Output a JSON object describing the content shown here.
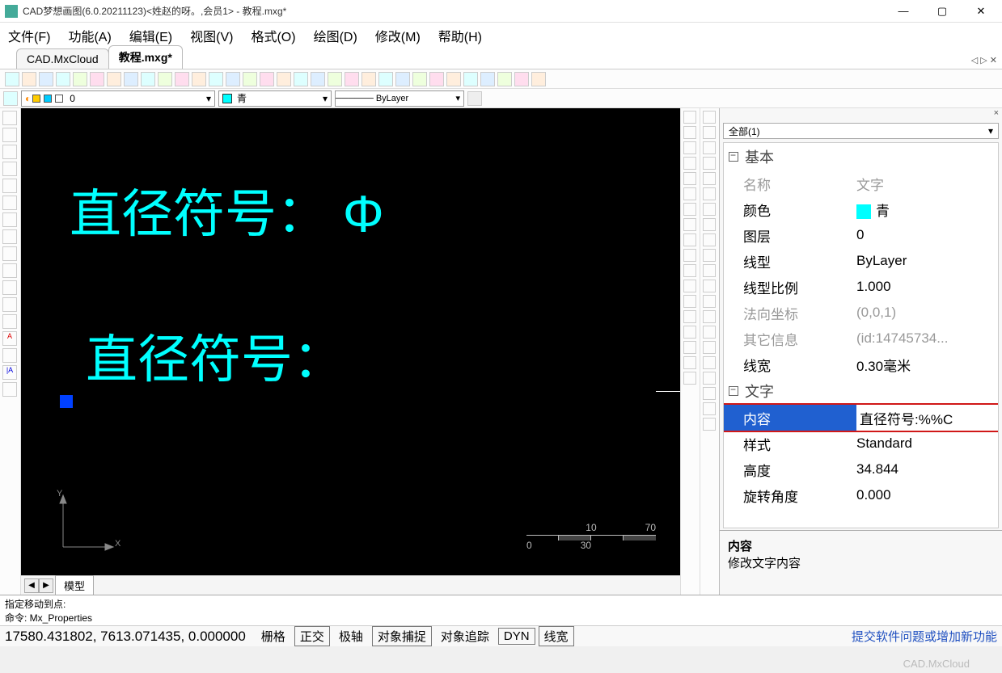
{
  "window": {
    "title": "CAD梦想画图(6.0.20211123)<姓赵的呀。,会员1> - 教程.mxg*",
    "min": "—",
    "max": "▢",
    "close": "✕"
  },
  "menu": {
    "file": "文件(F)",
    "func": "功能(A)",
    "edit": "编辑(E)",
    "view": "视图(V)",
    "format": "格式(O)",
    "draw": "绘图(D)",
    "modify": "修改(M)",
    "help": "帮助(H)"
  },
  "tabs": {
    "t1": "CAD.MxCloud",
    "t2": "教程.mxg*",
    "nav": "◁ ▷ ✕"
  },
  "propbar": {
    "layer": "0",
    "color": "青",
    "linetype": "────── ByLayer"
  },
  "canvas": {
    "line1": "直径符号： Φ",
    "line2": "直径符号：",
    "model_tab": "模型",
    "ruler": {
      "a": "10",
      "b": "70",
      "c": "0",
      "d": "30"
    }
  },
  "panel": {
    "close": "×",
    "selector": "全部(1)",
    "cat_basic": "基本",
    "cat_text": "文字",
    "rows": {
      "name": {
        "k": "名称",
        "v": "文字"
      },
      "color": {
        "k": "颜色",
        "v": "青"
      },
      "layer": {
        "k": "图层",
        "v": "0"
      },
      "linetype": {
        "k": "线型",
        "v": "ByLayer"
      },
      "ltscale": {
        "k": "线型比例",
        "v": "1.000"
      },
      "normal": {
        "k": "法向坐标",
        "v": "(0,0,1)"
      },
      "other": {
        "k": "其它信息",
        "v": "(id:14745734..."
      },
      "lweight": {
        "k": "线宽",
        "v": "0.30毫米"
      },
      "content": {
        "k": "内容",
        "v": "直径符号:%%C"
      },
      "style": {
        "k": "样式",
        "v": "Standard"
      },
      "height": {
        "k": "高度",
        "v": "34.844"
      },
      "rotation": {
        "k": "旋转角度",
        "v": "0.000"
      }
    },
    "desc_title": "内容",
    "desc_body": "修改文字内容"
  },
  "cmdline": {
    "l1": "指定移动到点:",
    "l2": "命令: Mx_Properties"
  },
  "status": {
    "coords": "17580.431802, 7613.071435, 0.000000",
    "b1": "栅格",
    "b2": "正交",
    "b3": "极轴",
    "b4": "对象捕捉",
    "b5": "对象追踪",
    "b6": "DYN",
    "b7": "线宽",
    "link": "提交软件问题或增加新功能",
    "watermark": "CAD.MxCloud"
  }
}
